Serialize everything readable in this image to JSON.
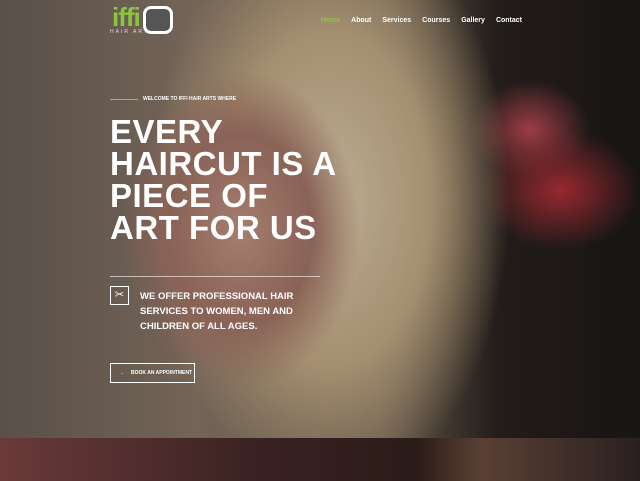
{
  "logo": {
    "text": "iffi",
    "subtitle": "HAIR ART"
  },
  "nav": [
    "Home",
    "About",
    "Services",
    "Courses",
    "Gallery",
    "Contact"
  ],
  "hero": {
    "welcome": "WELCOME TO IFFI HAIR ARTS WHERE",
    "headline": "EVERY HAIRCUT IS A PIECE OF ART FOR US",
    "offer": "WE OFFER PROFESSIONAL HAIR SERVICES TO WOMEN, MEN AND CHILDREN OF ALL AGES.",
    "button": "BOOK AN APPOINTMENT",
    "arrow": "→",
    "scissors": "✂"
  },
  "colors": {
    "accent": "#8cc63f"
  }
}
